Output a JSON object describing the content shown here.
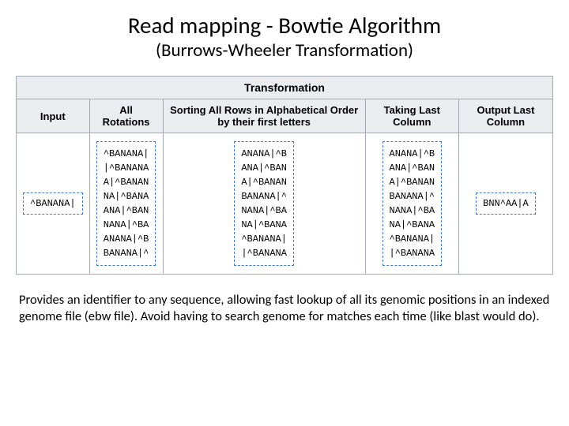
{
  "title": "Read mapping - Bowtie Algorithm",
  "subtitle": "(Burrows-Wheeler Transformation)",
  "table": {
    "header_main": "Transformation",
    "headers": {
      "input": "Input",
      "rotations": "All Rotations",
      "sorting": "Sorting All Rows in Alphabetical Order by their first letters",
      "taking": "Taking Last Column",
      "output": "Output Last Column"
    },
    "input_value": "^BANANA|",
    "rotations_lines": "^BANANA|\n|^BANANA\nA|^BANAN\nNA|^BANA\nANA|^BAN\nNANA|^BA\nANANA|^B\nBANANA|^",
    "sorted_lines": "ANANA|^B\nANA|^BAN\nA|^BANAN\nBANANA|^\nNANA|^BA\nNA|^BANA\n^BANANA|\n|^BANANA",
    "taking_lines": "ANANA|^B\nANA|^BAN\nA|^BANAN\nBANANA|^\nNANA|^BA\nNA|^BANA\n^BANANA|\n|^BANANA",
    "output_value": "BNN^AA|A"
  },
  "caption": "Provides an identifier to any sequence, allowing fast lookup of all its genomic positions in an indexed genome file (ebw file). Avoid having to search genome for matches each time (like blast would do)."
}
